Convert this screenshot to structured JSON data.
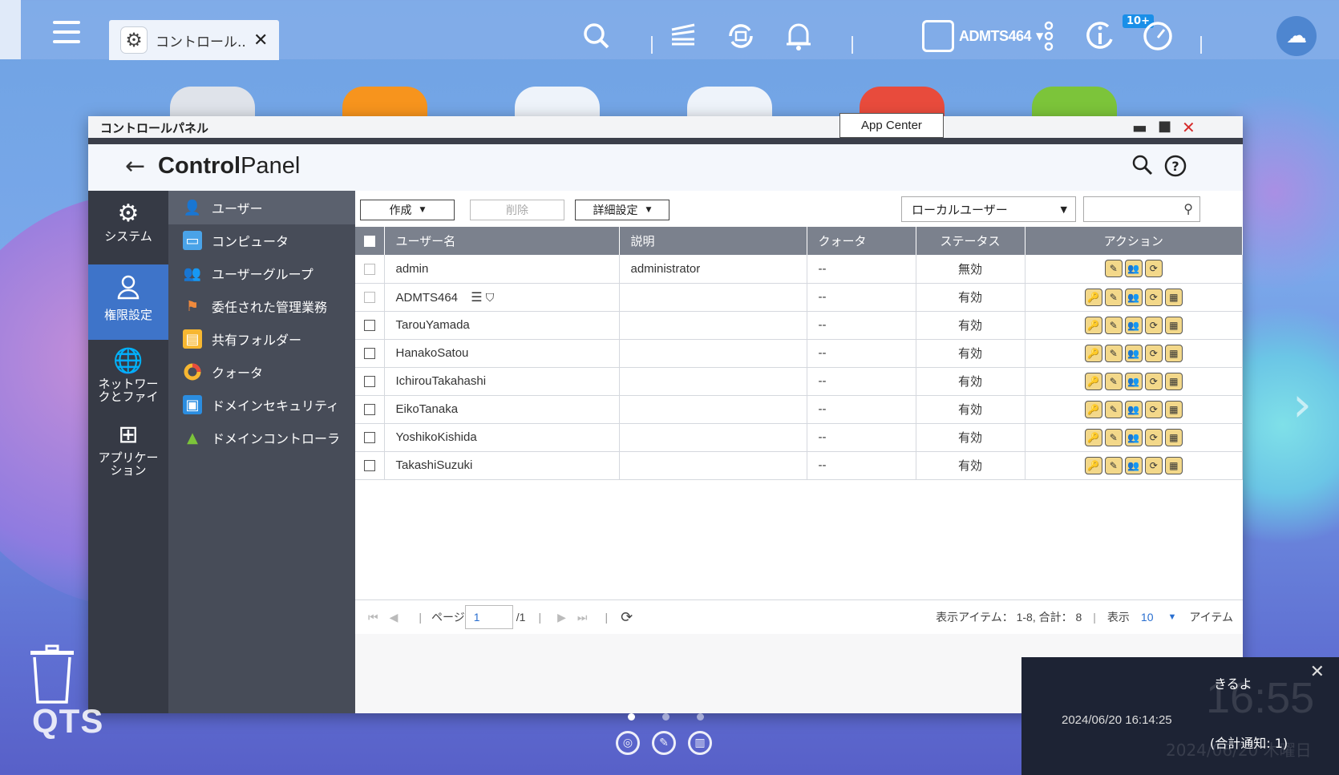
{
  "taskbar": {
    "tab_label": "コントロール...",
    "username": "ADMTS464",
    "badge": "10+"
  },
  "tooltip": "App Center",
  "window": {
    "title": "コントロールパネル",
    "brand_bold": "Control",
    "brand_rest": "Panel"
  },
  "nav1": [
    {
      "label": "システム",
      "icon": "gear-icon"
    },
    {
      "label": "権限設定",
      "icon": "user-icon"
    },
    {
      "label": "ネットワークとファイ",
      "icon": "globe-icon"
    },
    {
      "label": "アプリケーション",
      "icon": "apps-icon"
    }
  ],
  "nav2": [
    {
      "label": "ユーザー"
    },
    {
      "label": "コンピュータ"
    },
    {
      "label": "ユーザーグループ"
    },
    {
      "label": "委任された管理業務"
    },
    {
      "label": "共有フォルダー"
    },
    {
      "label": "クォータ"
    },
    {
      "label": "ドメインセキュリティ"
    },
    {
      "label": "ドメインコントローラ"
    }
  ],
  "toolbar": {
    "create": "作成",
    "delete": "削除",
    "advanced": "詳細設定",
    "user_type": "ローカルユーザー"
  },
  "table": {
    "headers": [
      "ユーザー名",
      "説明",
      "クォータ",
      "ステータス",
      "アクション"
    ],
    "rows": [
      {
        "name": "admin",
        "desc": "administrator",
        "quota": "--",
        "status": "無効"
      },
      {
        "name": "ADMTS464",
        "desc": "",
        "quota": "--",
        "status": "有効"
      },
      {
        "name": "TarouYamada",
        "desc": "",
        "quota": "--",
        "status": "有効"
      },
      {
        "name": "HanakoSatou",
        "desc": "",
        "quota": "--",
        "status": "有効"
      },
      {
        "name": "IchirouTakahashi",
        "desc": "",
        "quota": "--",
        "status": "有効"
      },
      {
        "name": "EikoTanaka",
        "desc": "",
        "quota": "--",
        "status": "有効"
      },
      {
        "name": "YoshikoKishida",
        "desc": "",
        "quota": "--",
        "status": "有効"
      },
      {
        "name": "TakashiSuzuki",
        "desc": "",
        "quota": "--",
        "status": "有効"
      }
    ]
  },
  "pager": {
    "page_label": "ページ",
    "page_value": "1",
    "total_pages": "/1",
    "items_info": "表示アイテム： 1-8, 合計： 8",
    "show_label": "表示",
    "per_page": "10",
    "items_label": "アイテム"
  },
  "desktop": {
    "logo": "QTS"
  },
  "notification": {
    "message": "きるよ",
    "clock": "16:55",
    "timestamp": "2024/06/20 16:14:25",
    "count": "(合計通知: 1)",
    "date_ghost": "2024/06/20 木曜日"
  }
}
